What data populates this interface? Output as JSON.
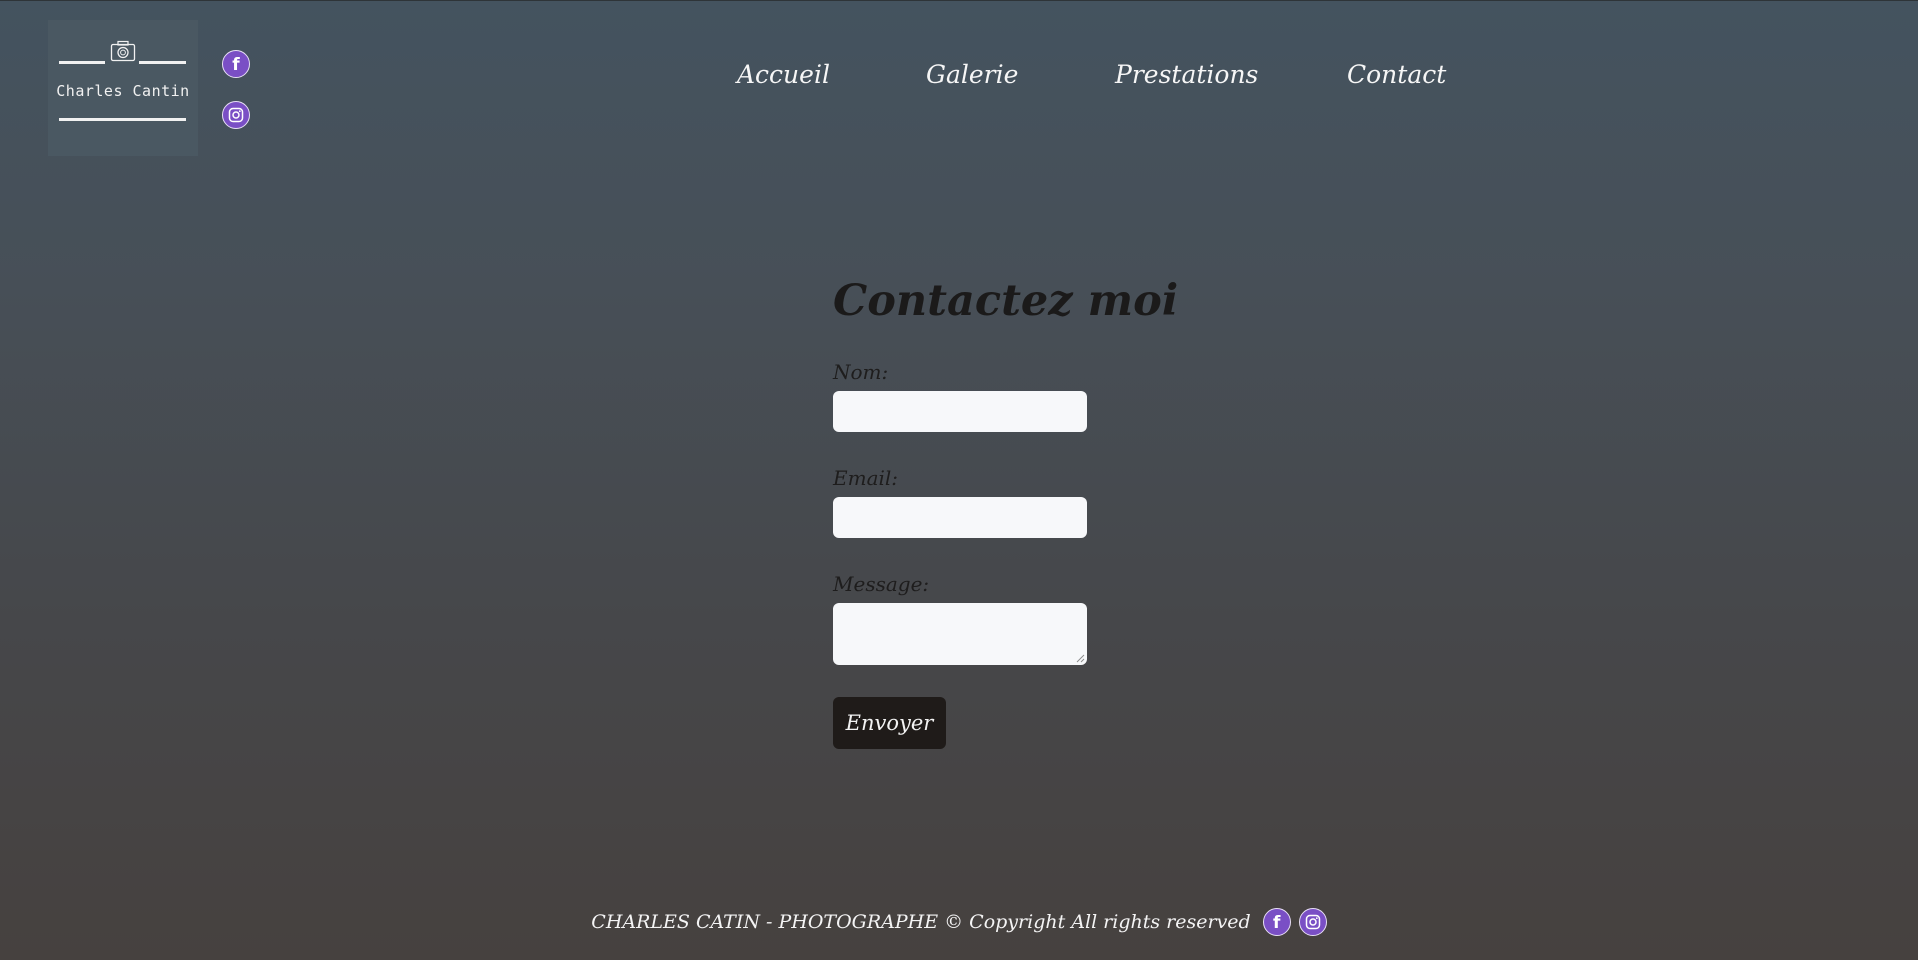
{
  "brand": {
    "logo_text": "Charles Cantin",
    "logo_icon": "camera-icon"
  },
  "header_social": [
    {
      "name": "facebook",
      "icon": "facebook-icon"
    },
    {
      "name": "instagram",
      "icon": "instagram-icon"
    }
  ],
  "nav": {
    "items": [
      {
        "label": "Accueil"
      },
      {
        "label": "Galerie"
      },
      {
        "label": "Prestations"
      },
      {
        "label": "Contact"
      }
    ]
  },
  "contact_form": {
    "title": "Contactez moi",
    "name_label": "Nom:",
    "name_value": "",
    "email_label": "Email:",
    "email_value": "",
    "message_label": "Message:",
    "message_value": "",
    "submit_label": "Envoyer"
  },
  "footer": {
    "text": "CHARLES CATIN - PHOTOGRAPHE © Copyright All rights reserved",
    "social": [
      {
        "name": "facebook",
        "icon": "facebook-icon"
      },
      {
        "name": "instagram",
        "icon": "instagram-icon"
      }
    ]
  },
  "colors": {
    "background_top": "#44535f",
    "background_bottom": "#46413f",
    "social_icon": "#7a4fc5",
    "button": "#1f1b19",
    "input": "#f7f8fa"
  }
}
